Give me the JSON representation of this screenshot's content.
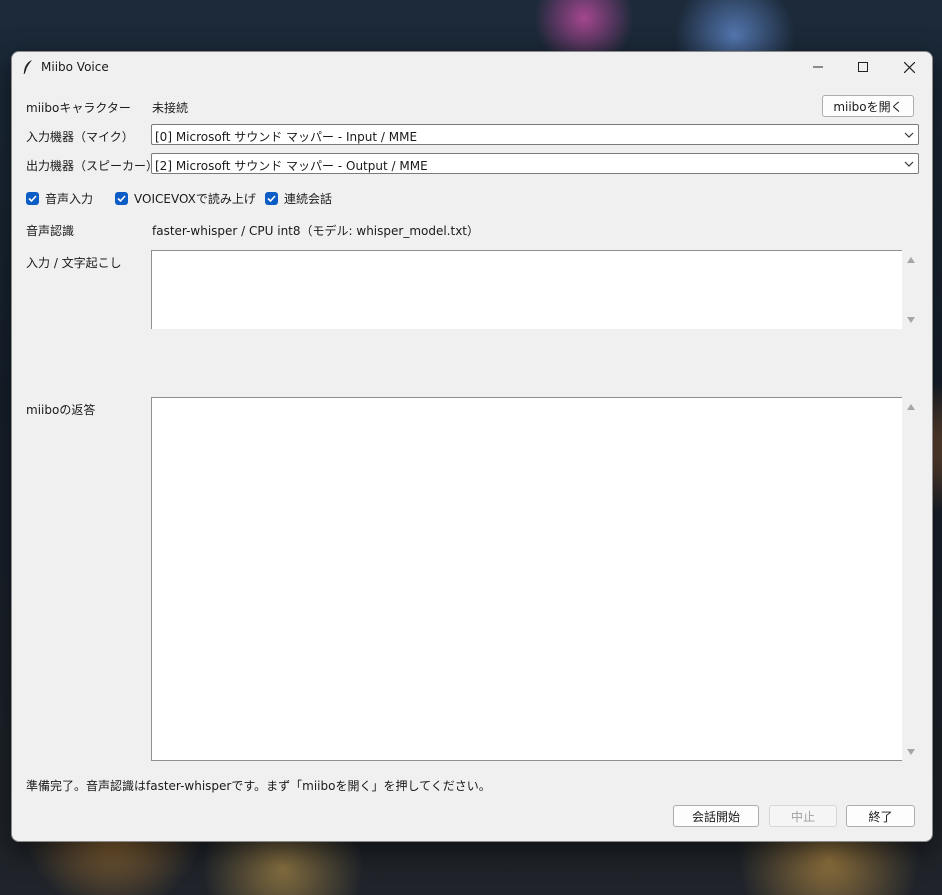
{
  "window": {
    "title": "Miibo Voice",
    "app_icon": "feather-icon",
    "controls": {
      "minimize": "minimize-icon",
      "maximize": "maximize-icon",
      "close": "close-icon"
    }
  },
  "character": {
    "label": "miiboキャラクター",
    "value": "未接続",
    "open_button": "miiboを開く"
  },
  "input_device": {
    "label": "入力機器（マイク）",
    "selected": "[0] Microsoft サウンド マッパー - Input / MME"
  },
  "output_device": {
    "label": "出力機器（スピーカー）",
    "selected": "[2] Microsoft サウンド マッパー - Output / MME"
  },
  "options": [
    {
      "label": "音声入力",
      "checked": true
    },
    {
      "label": "VOICEVOXで読み上げ",
      "checked": true
    },
    {
      "label": "連続会話",
      "checked": true
    }
  ],
  "speech_recognition": {
    "label": "音声認識",
    "value": "faster-whisper / CPU int8（モデル: whisper_model.txt）"
  },
  "transcript": {
    "label": "入力 / 文字起こし",
    "value": ""
  },
  "reply": {
    "label": "miiboの返答",
    "value": ""
  },
  "status": "準備完了。音声認識はfaster-whisperです。まず「miiboを開く」を押してください。",
  "buttons": {
    "start": "会話開始",
    "stop": "中止",
    "exit": "終了"
  },
  "colors": {
    "accent": "#0b5cc4",
    "window_bg": "#f0f0f0"
  }
}
